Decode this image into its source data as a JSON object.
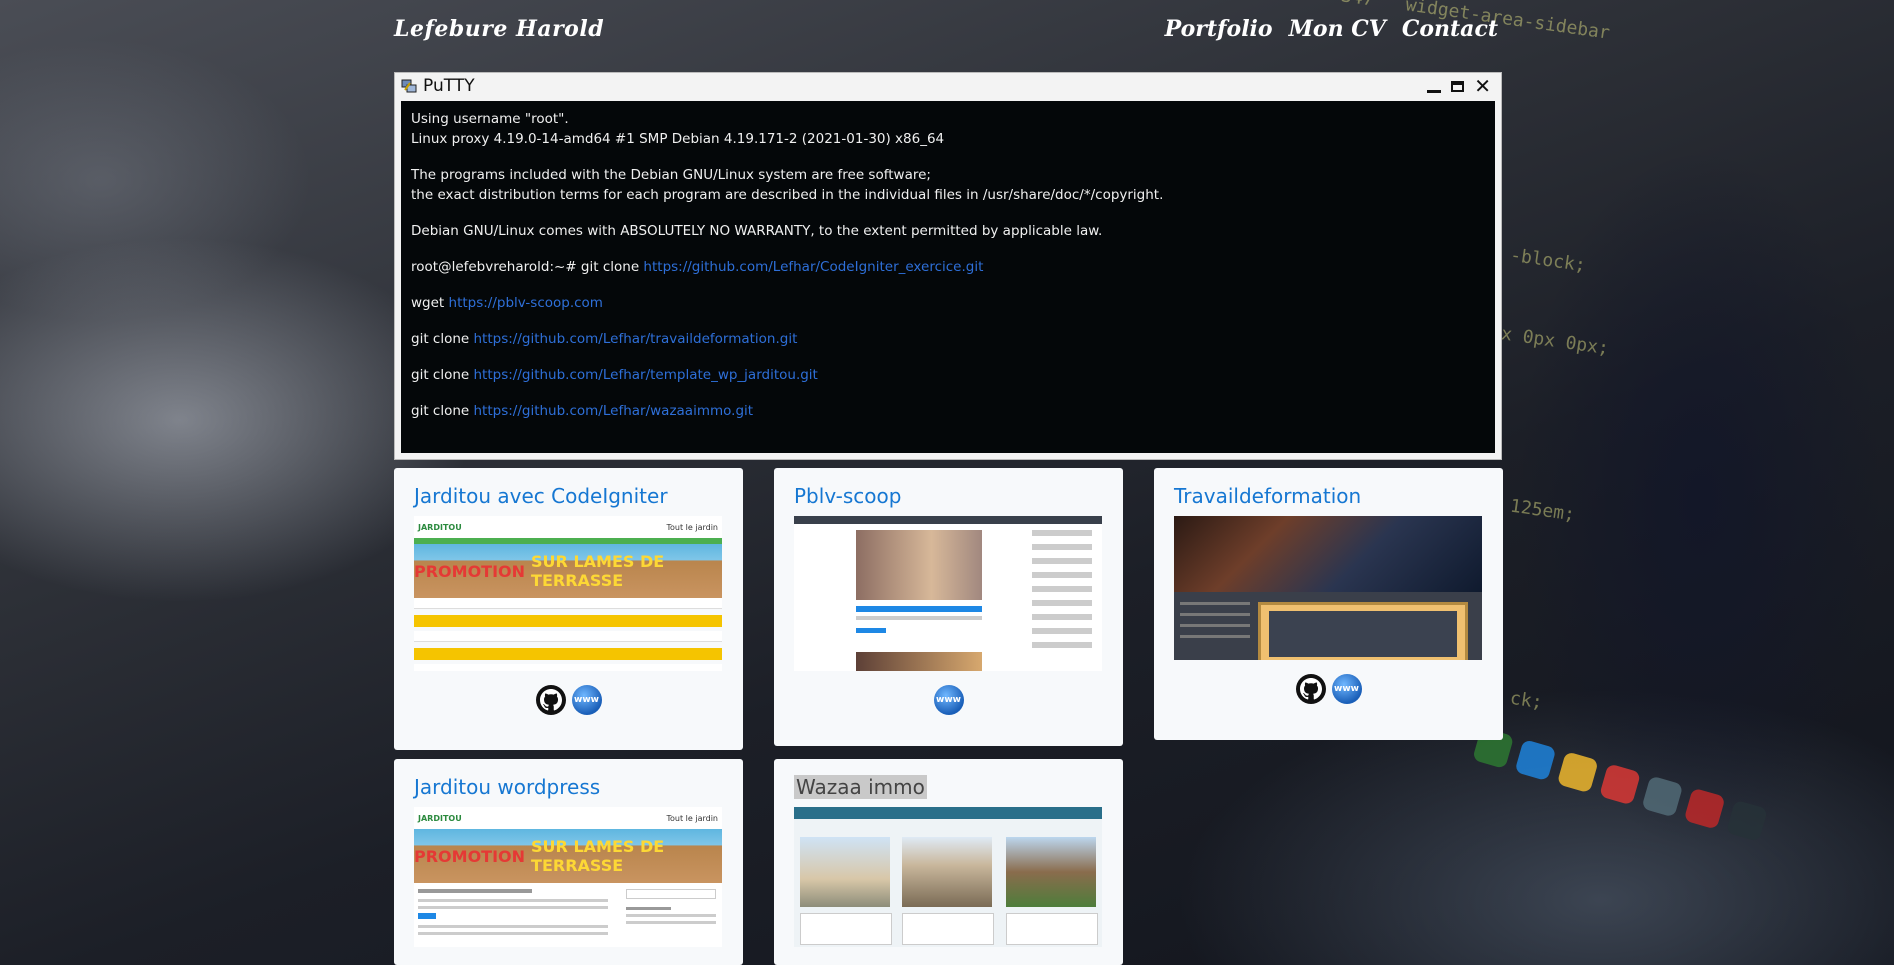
{
  "header": {
    "brand": "Lefebure Harold",
    "nav": [
      "Portfolio",
      "Mon CV",
      "Contact"
    ]
  },
  "putty": {
    "title": "PuTTY",
    "lines": {
      "l1": "Using username \"root\".",
      "l2": "Linux proxy 4.19.0-14-amd64 #1 SMP Debian 4.19.171-2 (2021-01-30) x86_64",
      "l3": "The programs included with the Debian GNU/Linux system are free software;",
      "l4": "the exact distribution terms for each program are described in the individual files in /usr/share/doc/*/copyright.",
      "l5": "Debian GNU/Linux comes with ABSOLUTELY NO WARRANTY, to the extent permitted by applicable law.",
      "l6_prefix": "root@lefebvreharold:~# git clone",
      "l6_link": "https://github.com/Lefhar/CodeIgniter_exercice.git",
      "l7_prefix": "wget",
      "l7_link": "https://pblv-scoop.com",
      "l8_prefix": "git clone",
      "l8_link": "https://github.com/Lefhar/travaildeformation.git",
      "l9_prefix": "git clone",
      "l9_link": "https://github.com/Lefhar/template_wp_jarditou.git",
      "l10_prefix": "git clone",
      "l10_link": "https://github.com/Lefhar/wazaaimmo.git"
    }
  },
  "cards": [
    {
      "title": "Jarditou avec CodeIgniter"
    },
    {
      "title": "Pblv-scoop"
    },
    {
      "title": "Travaildeformation"
    },
    {
      "title": "Jarditou wordpress"
    },
    {
      "title": "Wazaa immo"
    }
  ],
  "thumbs": {
    "jarditou_logo": "JARDITOU",
    "jarditou_tagline": "Tout le jardin",
    "promo_red": "PROMOTION",
    "promo_yellow": "SUR LAMES DE TERRASSE"
  },
  "icons": {
    "github": "github-icon",
    "www": "www"
  },
  "colors": {
    "link": "#1677d2",
    "terminal_bg": "#040709",
    "terminal_link": "#2e6fd8"
  }
}
